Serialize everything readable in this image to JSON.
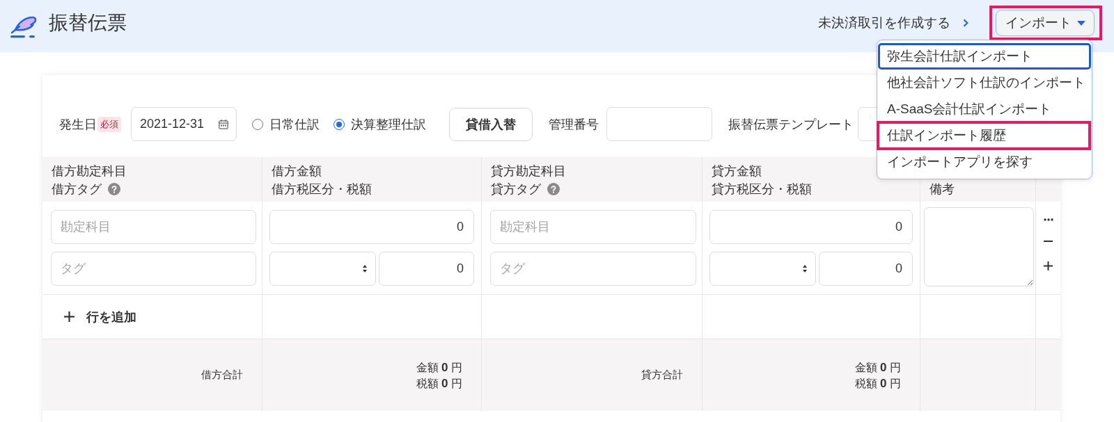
{
  "header": {
    "title": "振替伝票",
    "link": "未決済取引を作成する",
    "import_button": {
      "label": "インポート",
      "highlighted": true,
      "expanded": true,
      "menu": [
        {
          "label": "弥生会計仕訳インポート",
          "focused": true,
          "highlighted": false
        },
        {
          "label": "他社会計ソフト仕訳のインポート",
          "focused": false,
          "highlighted": false
        },
        {
          "label": "A-SaaS会計仕訳インポート",
          "focused": false,
          "highlighted": false
        },
        {
          "label": "仕訳インポート履歴",
          "focused": false,
          "highlighted": true
        },
        {
          "label": "インポートアプリを探す",
          "focused": false,
          "highlighted": false
        }
      ]
    }
  },
  "form": {
    "date": {
      "label": "発生日",
      "badge": "必須",
      "value": "2021-12-31"
    },
    "entry_types": [
      {
        "label": "日常仕訳",
        "selected": false
      },
      {
        "label": "決算整理仕訳",
        "selected": true
      }
    ],
    "swap_button": "貸借入替",
    "fields": [
      {
        "label": "管理番号"
      },
      {
        "label": "振替伝票テンプレート"
      }
    ]
  },
  "table": {
    "columns": [
      {
        "lines": [
          "借方勘定科目",
          "借方タグ"
        ],
        "help": true
      },
      {
        "lines": [
          "借方金額",
          "借方税区分・税額"
        ],
        "help": false
      },
      {
        "lines": [
          "貸方勘定科目",
          "貸方タグ"
        ],
        "help": true
      },
      {
        "lines": [
          "貸方金額",
          "貸方税区分・税額"
        ],
        "help": false
      },
      {
        "lines": [
          "備考"
        ],
        "help": false
      }
    ],
    "rows": [
      {
        "cells": [
          {
            "kind": "account",
            "fields": [
              {
                "placeholder": "勘定科目"
              },
              {
                "placeholder": "タグ"
              }
            ]
          },
          {
            "kind": "amount",
            "amount": "0",
            "tax": "0"
          },
          {
            "kind": "account",
            "fields": [
              {
                "placeholder": "勘定科目"
              },
              {
                "placeholder": "タグ"
              }
            ]
          },
          {
            "kind": "amount",
            "amount": "0",
            "tax": "0"
          },
          {
            "kind": "memo"
          },
          {
            "kind": "actions"
          }
        ]
      }
    ],
    "add_row": "行を追加",
    "totals": [
      {
        "kind": "label",
        "text": "借方合計"
      },
      {
        "kind": "sums",
        "lines": [
          "金額 **0** 円",
          "税額 **0** 円"
        ]
      },
      {
        "kind": "label",
        "text": "貸方合計"
      },
      {
        "kind": "sums",
        "lines": [
          "金額 **0** 円",
          "税額 **0** 円"
        ]
      }
    ]
  }
}
